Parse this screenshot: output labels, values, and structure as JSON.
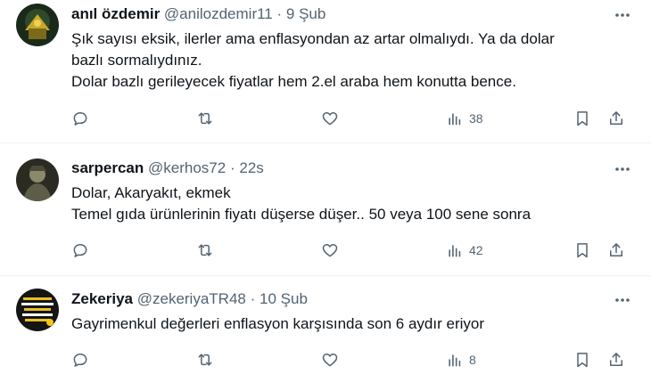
{
  "tweets": [
    {
      "name": "anıl özdemir",
      "handle": "@anilozdemir11",
      "sep": "·",
      "time": "9 Şub",
      "lines": [
        "Şık sayısı eksik, ilerler ama enflasyondan az artar olmalıydı. Ya da dolar",
        "bazlı sormalıydınız.",
        "Dolar bazlı gerileyecek fiyatlar hem 2.el araba hem konutta bence."
      ],
      "views": "38",
      "avatar_colors": [
        "#1a2a1a",
        "#c8a82a"
      ]
    },
    {
      "name": "sarpercan",
      "handle": "@kerhos72",
      "sep": "·",
      "time": "22s",
      "lines": [
        "Dolar, Akaryakıt, ekmek",
        "Temel gıda ürünlerinin fiyatı düşerse düşer.. 50 veya 100 sene sonra"
      ],
      "views": "42",
      "avatar_colors": [
        "#2b2b23",
        "#8a8a6a"
      ]
    },
    {
      "name": "Zekeriya",
      "handle": "@zekeriyaTR48",
      "sep": "·",
      "time": "10 Şub",
      "lines": [
        "Gayrimenkul değerleri enflasyon karşısında son 6 aydır eriyor"
      ],
      "views": "8",
      "avatar_colors": [
        "#151515",
        "#e8c020"
      ]
    }
  ],
  "icons": {
    "reply": "reply-icon",
    "retweet": "retweet-icon",
    "like": "like-icon",
    "views": "views-icon",
    "bookmark": "bookmark-icon",
    "share": "share-icon",
    "more": "more-icon"
  },
  "colors": {
    "text": "#0f1419",
    "secondary": "#536471",
    "divider": "#eff3f4"
  }
}
